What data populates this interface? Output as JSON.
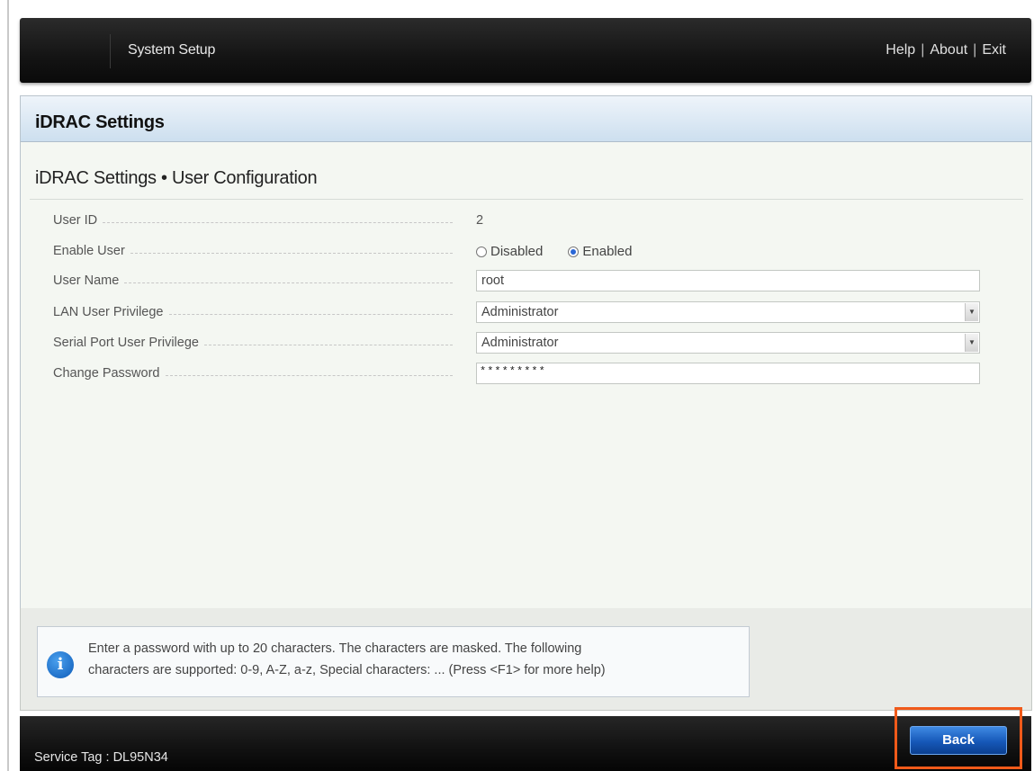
{
  "header": {
    "title": "System Setup",
    "links": [
      "Help",
      "About",
      "Exit"
    ]
  },
  "panel": {
    "title": "iDRAC Settings",
    "section_title": "iDRAC Settings • User Configuration"
  },
  "form": {
    "user_id": {
      "label": "User ID",
      "value": "2"
    },
    "enable_user": {
      "label": "Enable User",
      "options": [
        "Disabled",
        "Enabled"
      ],
      "selected": "Enabled"
    },
    "user_name": {
      "label": "User Name",
      "value": "root"
    },
    "lan_privilege": {
      "label": "LAN User Privilege",
      "value": "Administrator"
    },
    "serial_privilege": {
      "label": "Serial Port User Privilege",
      "value": "Administrator"
    },
    "change_password": {
      "label": "Change Password",
      "value": "*********"
    }
  },
  "help": {
    "icon": "info-icon",
    "line1": "Enter a password with up to 20 characters. The characters are masked. The following",
    "line2": "characters are supported: 0-9, A-Z, a-z, Special characters: ... (Press <F1> for more help)"
  },
  "footer": {
    "service_tag": "Service Tag : DL95N34",
    "back_label": "Back"
  },
  "colors": {
    "accent": "#1658b8",
    "highlight": "#f05a1a",
    "header_bg": "#141414"
  }
}
